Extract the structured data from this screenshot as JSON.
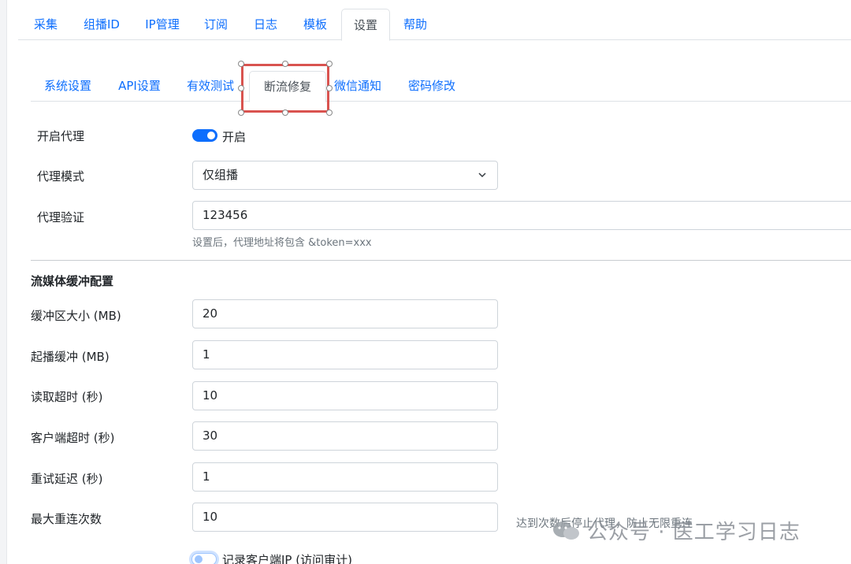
{
  "top_tabs": [
    "采集",
    "组播ID",
    "IP管理",
    "订阅",
    "日志",
    "模板",
    "设置",
    "帮助"
  ],
  "top_active": "设置",
  "sub_tabs": [
    "系统设置",
    "API设置",
    "有效测试",
    "断流修复",
    "微信通知",
    "密码修改"
  ],
  "sub_active": "断流修复",
  "proxy": {
    "enable_label": "开启代理",
    "enable_state": "开启",
    "mode_label": "代理模式",
    "mode_value": "仅组播",
    "auth_label": "代理验证",
    "auth_value": "123456",
    "auth_hint": "设置后，代理地址将包含 &token=xxx"
  },
  "buffer": {
    "section_title": "流媒体缓冲配置",
    "size_label": "缓冲区大小 (MB)",
    "size_value": "20",
    "start_label": "起播缓冲 (MB)",
    "start_value": "1",
    "read_timeout_label": "读取超时 (秒)",
    "read_timeout_value": "10",
    "client_timeout_label": "客户端超时 (秒)",
    "client_timeout_value": "30",
    "retry_delay_label": "重试延迟 (秒)",
    "retry_delay_value": "1",
    "max_retry_label": "最大重连次数",
    "max_retry_value": "10",
    "max_retry_hint": "达到次数后停止代理，防止无限重连"
  },
  "audit": {
    "label": "记录客户端IP (访问审计)"
  },
  "watermark": "公众号 · 医工学习日志",
  "colors": {
    "accent": "#0d6efd",
    "highlight_frame": "#d9534f"
  },
  "icons": {
    "select": "chevron-down-icon",
    "watermark": "wechat-icon"
  }
}
